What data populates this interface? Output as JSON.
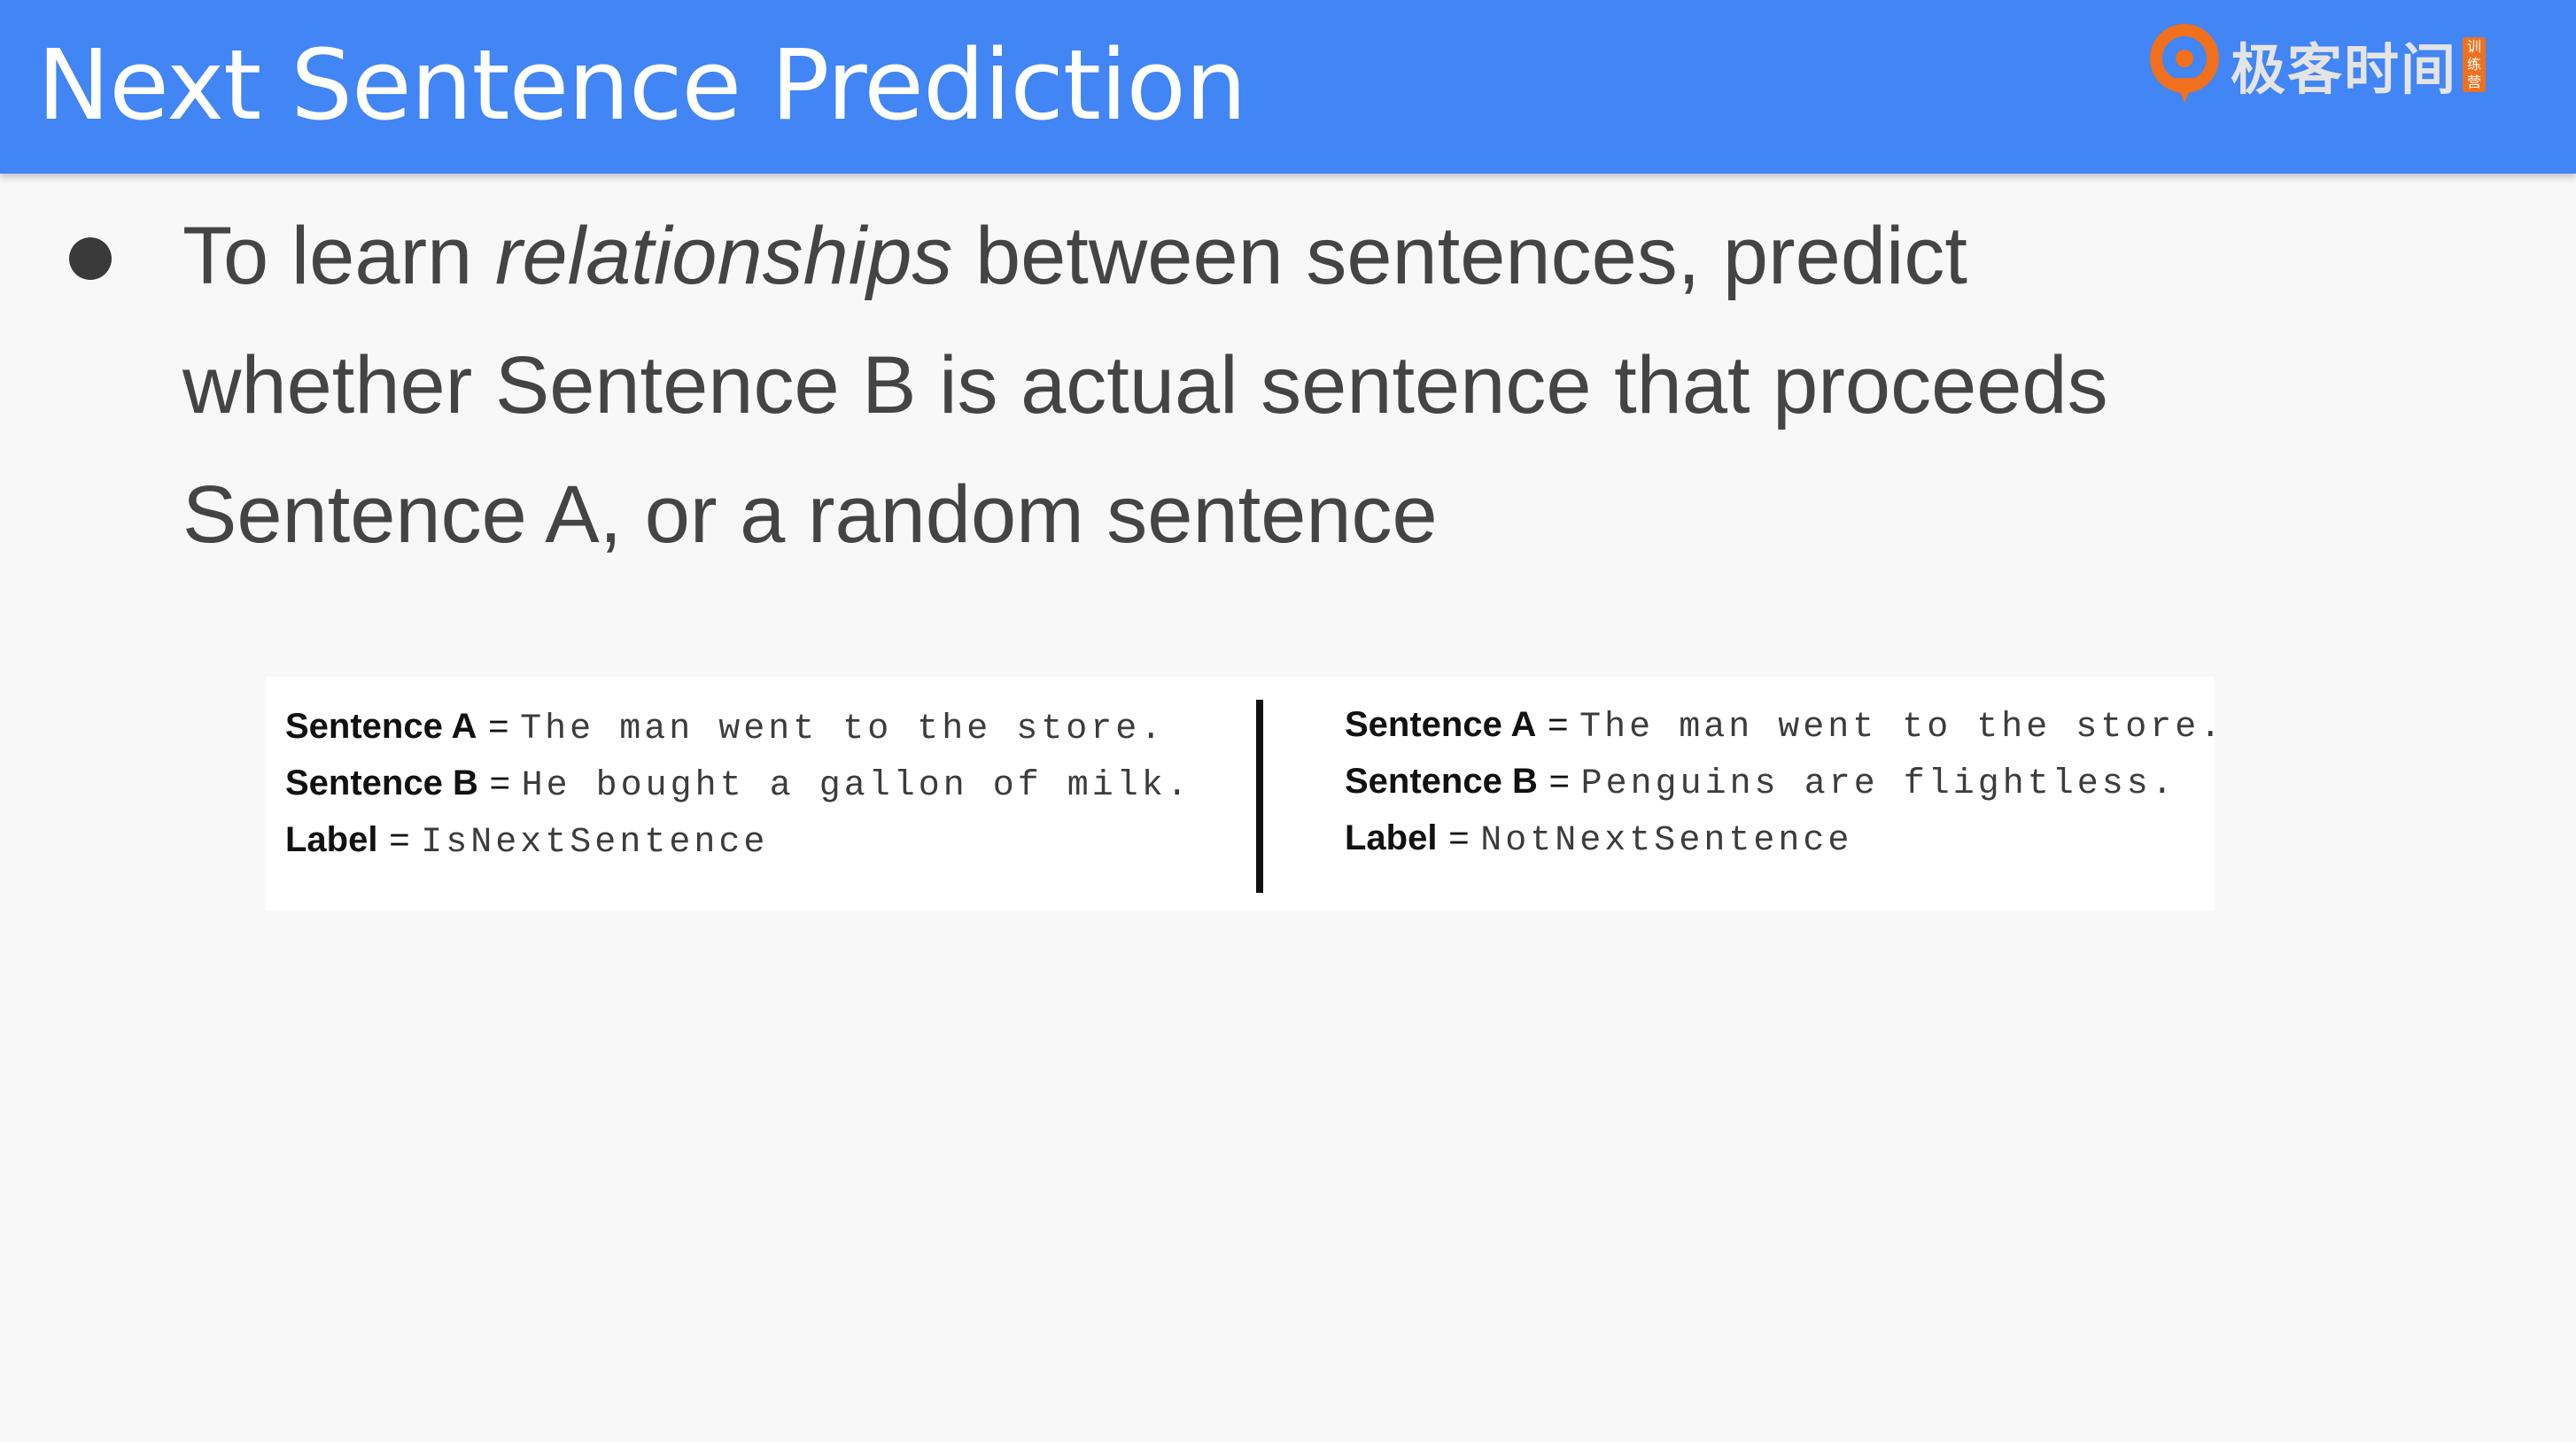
{
  "header": {
    "title": "Next Sentence Prediction",
    "brand": {
      "name": "极客时间",
      "badge": [
        "训",
        "练",
        "营"
      ],
      "accent_color": "#f0701d"
    },
    "background_color": "#4285f4"
  },
  "bullet": {
    "text_before": "To learn ",
    "emphasis": "relationships",
    "text_after": " between sentences, predict whether Sentence B is actual sentence that  proceeds Sentence A, or a random sentence"
  },
  "examples": [
    {
      "sentence_a_key": "Sentence A",
      "sentence_a_value": "The man went to the store.",
      "sentence_b_key": "Sentence B",
      "sentence_b_value": "He bought a gallon of milk.",
      "label_key": "Label",
      "label_value": "IsNextSentence"
    },
    {
      "sentence_a_key": "Sentence A",
      "sentence_a_value": "The man went to the store.",
      "sentence_b_key": "Sentence B",
      "sentence_b_value": "Penguins are flightless.",
      "label_key": "Label",
      "label_value": "NotNextSentence"
    }
  ],
  "equals_sign": "="
}
